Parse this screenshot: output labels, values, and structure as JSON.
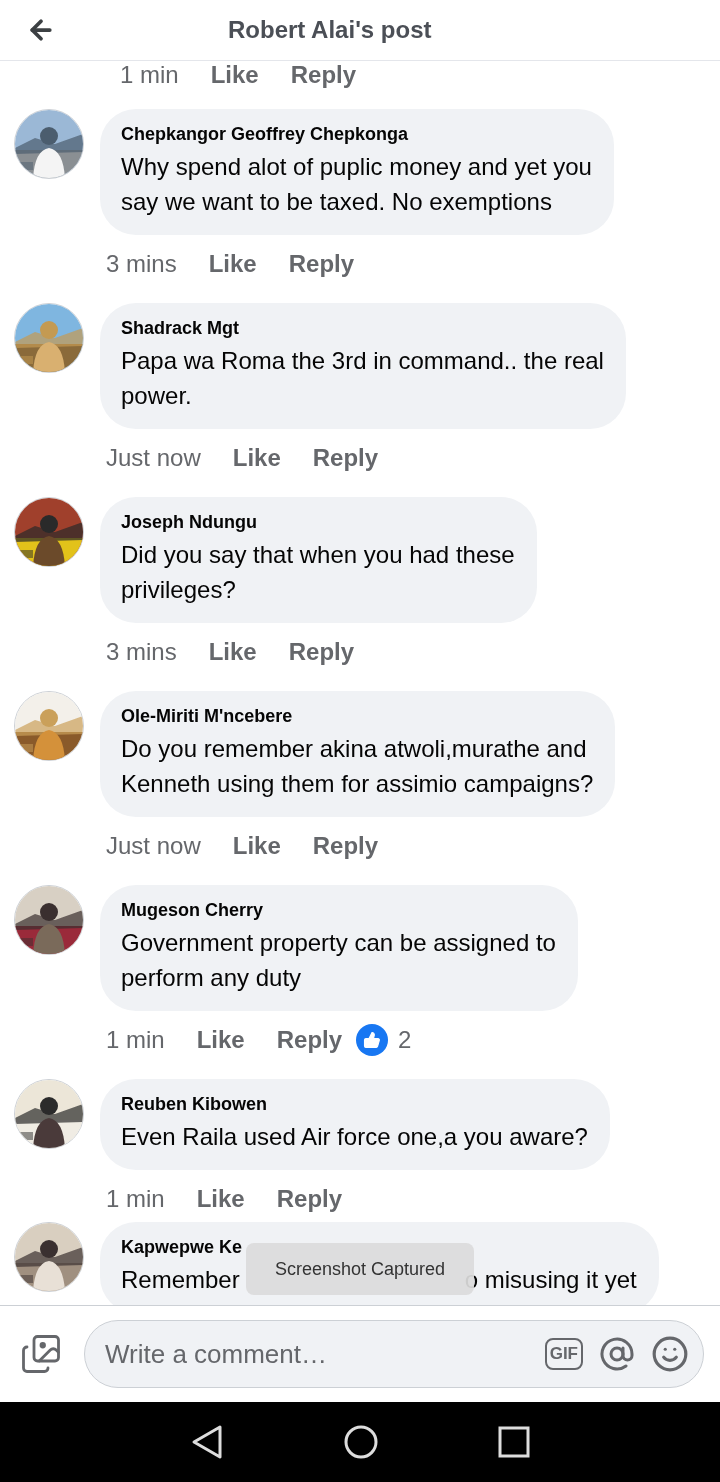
{
  "header": {
    "title": "Robert Alai's post"
  },
  "top_actions": {
    "time": "1 min",
    "like": "Like",
    "reply": "Reply"
  },
  "comments": [
    {
      "author": "Chepkangor Geoffrey Chepkonga",
      "text": "Why spend alot of puplic money and yet you\nsay we want to be taxed. No exemptions",
      "time": "3 mins",
      "like": "Like",
      "reply": "Reply"
    },
    {
      "author": "Shadrack Mgt",
      "text": "Papa wa Roma the 3rd in command.. the real\npower.",
      "time": "Just now",
      "like": "Like",
      "reply": "Reply"
    },
    {
      "author": "Joseph Ndungu",
      "text": "Did you say that when you had these\nprivileges?",
      "time": "3 mins",
      "like": "Like",
      "reply": "Reply"
    },
    {
      "author": "Ole-Miriti M'ncebere",
      "text": "Do you remember akina atwoli,murathe and\nKenneth using them for assimio campaigns?",
      "time": "Just now",
      "like": "Like",
      "reply": "Reply"
    },
    {
      "author": "Mugeson Cherry",
      "text": "Government property can be assigned to\nperform any duty",
      "time": "1 min",
      "like": "Like",
      "reply": "Reply",
      "reactions": "2"
    },
    {
      "author": "Reuben Kibowen",
      "text": "Even Raila used Air force one,a you aware?",
      "time": "1 min",
      "like": "Like",
      "reply": "Reply"
    }
  ],
  "partial_comment": {
    "author": "Kapwepwe Ke",
    "text_left": "Remember",
    "text_right": "o misusing it yet"
  },
  "toast": {
    "text": "Screenshot Captured"
  },
  "composer": {
    "placeholder": "Write a comment…",
    "gif_label": "GIF"
  }
}
